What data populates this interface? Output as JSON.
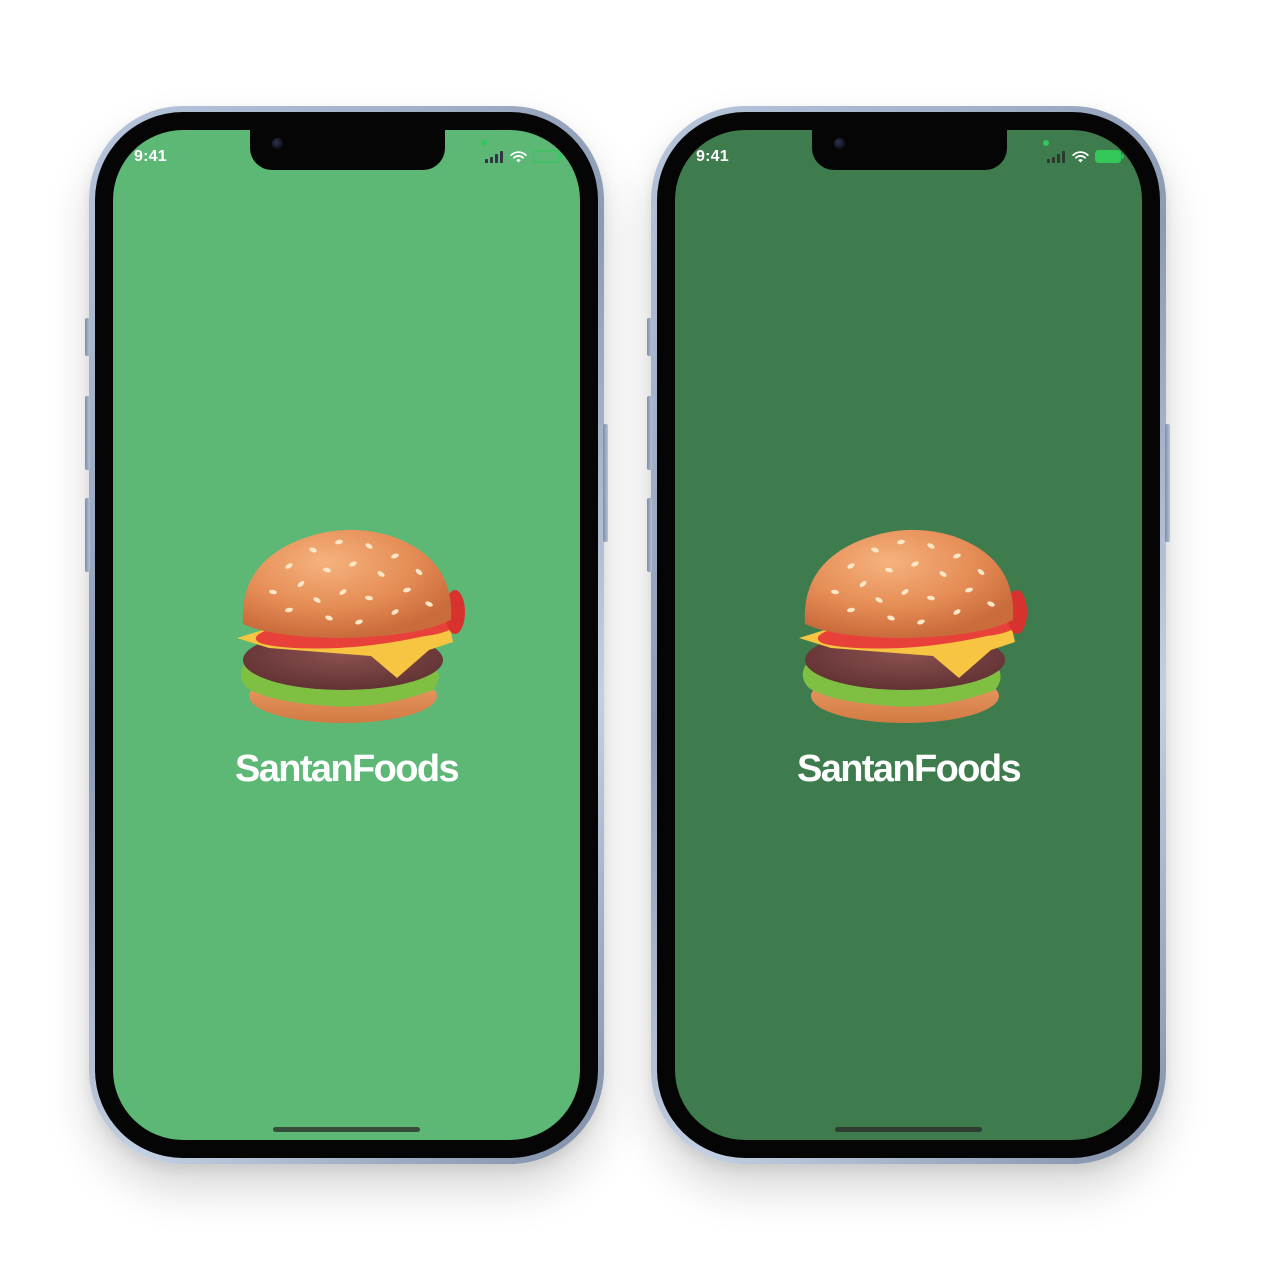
{
  "screens": [
    {
      "variant": "light",
      "background": "#5db876",
      "status_bar": {
        "time": "9:41",
        "battery_color": "#34c759"
      },
      "brand_name": "SantanFoods",
      "icon": "hamburger-icon"
    },
    {
      "variant": "dark",
      "background": "#3e7c4e",
      "status_bar": {
        "time": "9:41",
        "battery_color": "#34c759"
      },
      "brand_name": "SantanFoods",
      "icon": "hamburger-icon"
    }
  ]
}
